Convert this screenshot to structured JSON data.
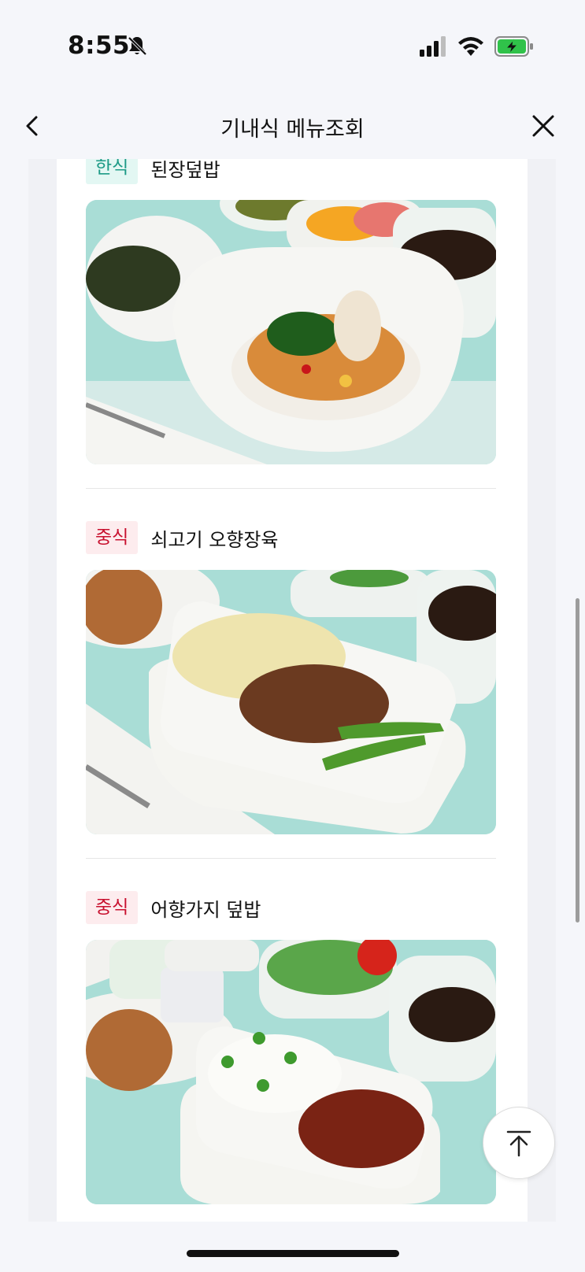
{
  "status_bar": {
    "time": "8:55",
    "icons": [
      "bell-slash-icon",
      "cellular-signal-icon",
      "wifi-icon",
      "battery-charging-icon"
    ]
  },
  "nav": {
    "title": "기내식 메뉴조회",
    "back_icon": "chevron-left-icon",
    "close_icon": "close-icon"
  },
  "menu_items": [
    {
      "category": "한식",
      "category_color": "#1c9a86",
      "category_bg": "#e3f7f3",
      "name": "된장덮밥"
    },
    {
      "category": "중식",
      "category_color": "#c8102e",
      "category_bg": "#fdecee",
      "name": "쇠고기 오향장육"
    },
    {
      "category": "중식",
      "category_color": "#c8102e",
      "category_bg": "#fdecee",
      "name": "어향가지 덮밥"
    }
  ],
  "scroll_top_icon": "arrow-up-to-top-icon",
  "colors": {
    "background": "#f5f6fa",
    "tray": "#a9ddd6",
    "korean_accent": "#1c9a86",
    "chinese_accent": "#c8102e"
  }
}
